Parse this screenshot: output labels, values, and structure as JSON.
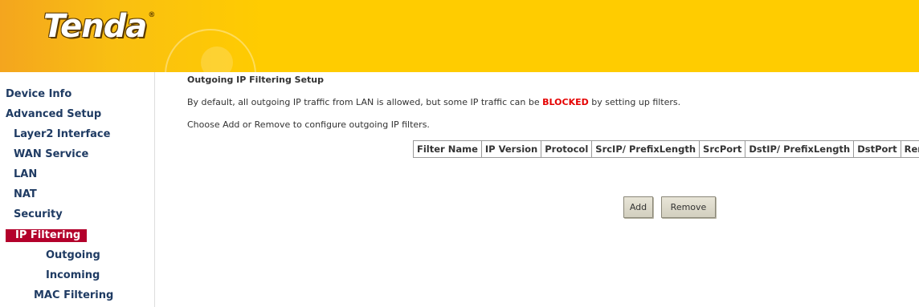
{
  "brand": {
    "logo_text": "Tenda",
    "reg_mark": "®"
  },
  "sidebar": {
    "items": [
      {
        "label": "Device Info"
      },
      {
        "label": "Advanced Setup"
      },
      {
        "label": "Layer2 Interface"
      },
      {
        "label": "WAN Service"
      },
      {
        "label": "LAN"
      },
      {
        "label": "NAT"
      },
      {
        "label": "Security"
      },
      {
        "label": "IP Filtering",
        "selected": true
      },
      {
        "label": "Outgoing"
      },
      {
        "label": "Incoming"
      },
      {
        "label": "MAC Filtering"
      }
    ]
  },
  "main": {
    "title": "Outgoing IP Filtering Setup",
    "desc1_prefix": "By default, all outgoing IP traffic from LAN is allowed, but some IP traffic can be ",
    "desc1_blocked": "BLOCKED",
    "desc1_suffix": " by setting up filters.",
    "desc2": "Choose Add or Remove to configure outgoing IP filters.",
    "table": {
      "headers": [
        "Filter Name",
        "IP Version",
        "Protocol",
        "SrcIP/ PrefixLength",
        "SrcPort",
        "DstIP/ PrefixLength",
        "DstPort",
        "Remove"
      ]
    },
    "buttons": {
      "add": "Add",
      "remove": "Remove"
    }
  },
  "colors": {
    "banner": "#ffcc00",
    "nav_text": "#1f3b63",
    "selected_bg": "#b3002b",
    "blocked_text": "#e50000"
  }
}
